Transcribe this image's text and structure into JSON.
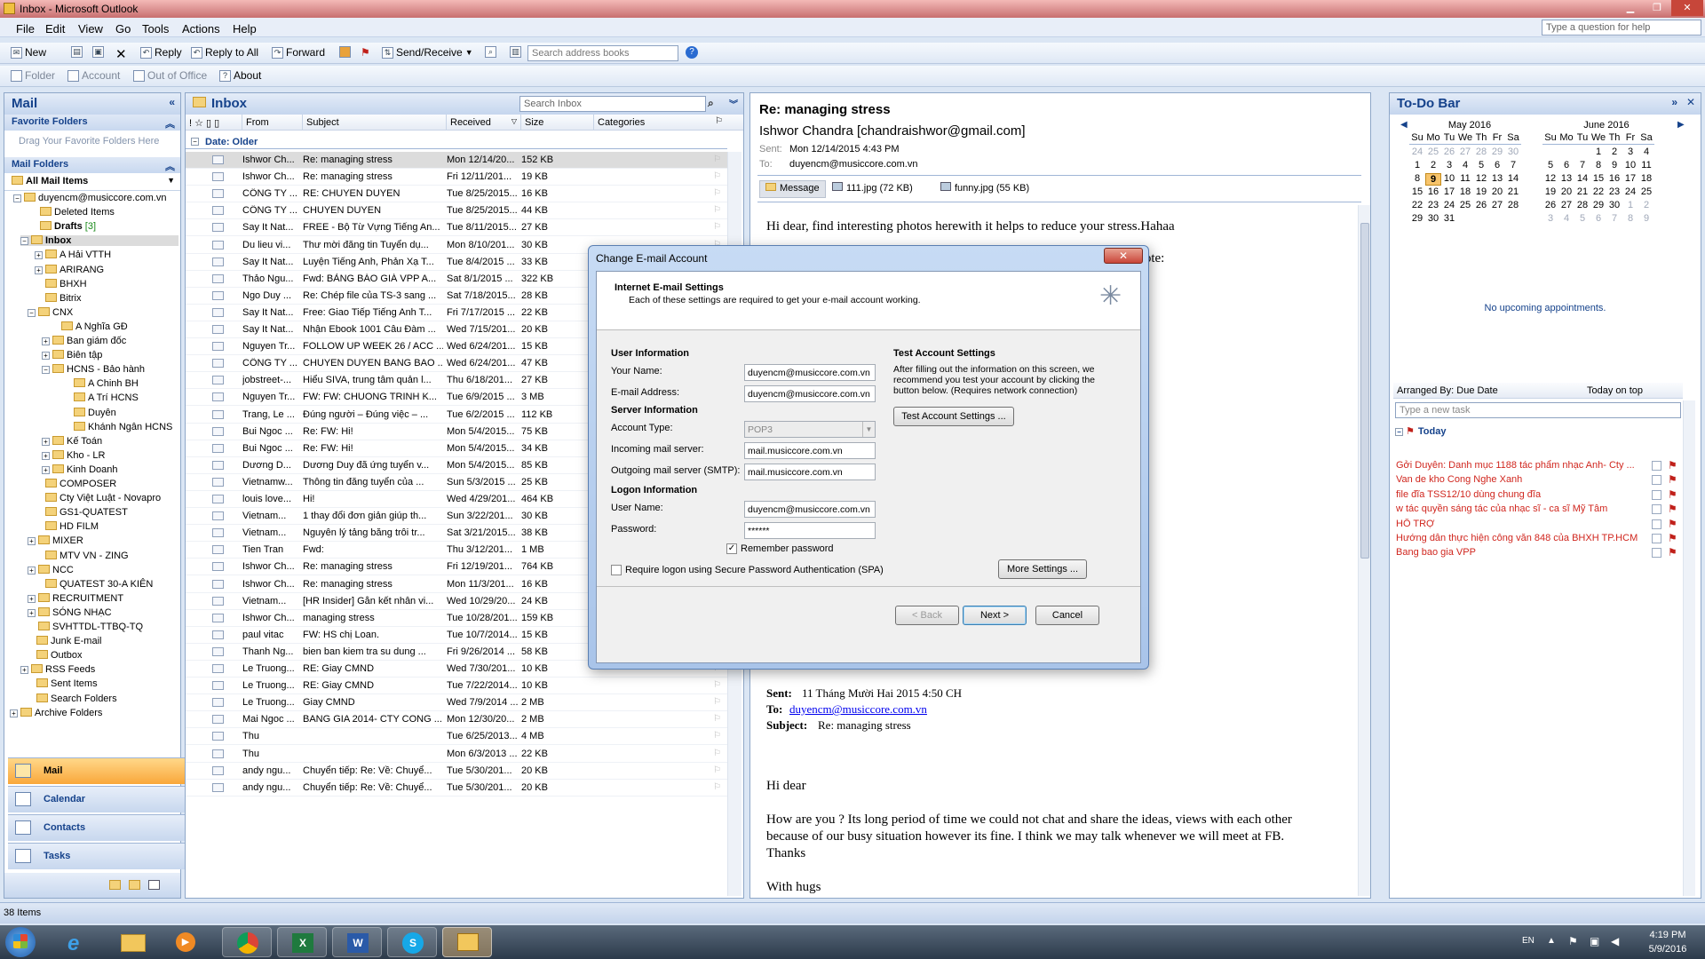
{
  "window": {
    "title": "Inbox - Microsoft Outlook"
  },
  "menu": [
    "File",
    "Edit",
    "View",
    "Go",
    "Tools",
    "Actions",
    "Help"
  ],
  "help_placeholder": "Type a question for help",
  "toolbar1": {
    "new": "New",
    "reply": "Reply",
    "reply_all": "Reply to All",
    "forward": "Forward",
    "send_receive": "Send/Receive",
    "search_placeholder": "Search address books"
  },
  "toolbar2": {
    "folder": "Folder",
    "account": "Account",
    "out_of_office": "Out of Office",
    "about": "About"
  },
  "nav": {
    "title": "Mail",
    "favorite_folders": "Favorite Folders",
    "favorite_hint": "Drag Your Favorite Folders Here",
    "mail_folders": "Mail Folders",
    "all_mail_items": "All Mail Items",
    "tree": [
      "duyencm@musiccore.com.vn",
      "Deleted Items",
      "Drafts",
      "Inbox",
      "A Hải VTTH",
      "ARIRANG",
      "BHXH",
      "Bitrix",
      "CNX",
      "A Nghĩa GĐ",
      "Ban giám đốc",
      "Biên tập",
      "HCNS - Bảo hành",
      "A Chinh BH",
      "A Trí HCNS",
      "Duyên",
      "Khánh Ngân HCNS",
      "Kế Toán",
      "Kho - LR",
      "Kinh Doanh",
      "COMPOSER",
      "Cty Việt Luật - Novapro",
      "GS1-QUATEST",
      "HD FILM",
      "MIXER",
      "MTV VN - ZING",
      "NCC",
      "QUATEST 30-A KIÊN",
      "RECRUITMENT",
      "SÓNG NHẠC",
      "SVHTTDL-TTBQ-TQ",
      "Junk E-mail",
      "Outbox",
      "RSS Feeds",
      "Sent Items",
      "Search Folders",
      "Archive Folders"
    ],
    "drafts_count": "[3]",
    "buttons": [
      "Mail",
      "Calendar",
      "Contacts",
      "Tasks"
    ]
  },
  "inbox": {
    "title": "Inbox",
    "search_placeholder": "Search Inbox",
    "columns": {
      "from": "From",
      "subject": "Subject",
      "received": "Received",
      "size": "Size",
      "categories": "Categories"
    },
    "group": "Date: Older",
    "rows": [
      [
        "Ishwor Ch...",
        "Re: managing stress",
        "Mon 12/14/20...",
        "152 KB"
      ],
      [
        "Ishwor Ch...",
        "Re: managing stress",
        "Fri 12/11/201...",
        "19 KB"
      ],
      [
        "CÔNG TY ...",
        "RE: CHUYEN DUYEN",
        "Tue 8/25/2015...",
        "16 KB"
      ],
      [
        "CÔNG TY ...",
        "CHUYEN DUYEN",
        "Tue 8/25/2015...",
        "44 KB"
      ],
      [
        "Say It Nat...",
        "FREE - Bộ Từ Vựng Tiếng An...",
        "Tue 8/11/2015...",
        "27 KB"
      ],
      [
        "Du lieu vi...",
        "Thư mời đăng tin Tuyển dụ...",
        "Mon 8/10/201...",
        "30 KB"
      ],
      [
        "Say It Nat...",
        "Luyện Tiếng Anh, Phản Xạ T...",
        "Tue 8/4/2015 ...",
        "33 KB"
      ],
      [
        "Thảo Ngu...",
        "Fwd: BẢNG BÁO GIÁ VPP A...",
        "Sat 8/1/2015 ...",
        "322 KB"
      ],
      [
        "Ngo Duy ...",
        "Re: Chép file của TS-3 sang ...",
        "Sat 7/18/2015...",
        "28 KB"
      ],
      [
        "Say It Nat...",
        "Free: Giao Tiếp Tiếng Anh T...",
        "Fri 7/17/2015 ...",
        "22 KB"
      ],
      [
        "Say It Nat...",
        "Nhận Ebook 1001 Câu Đàm ...",
        "Wed 7/15/201...",
        "20 KB"
      ],
      [
        "Nguyen Tr...",
        "FOLLOW UP WEEK 26 / ACC ...",
        "Wed 6/24/201...",
        "15 KB"
      ],
      [
        "CÔNG TY ...",
        "CHUYEN DUYEN BANG BAO ...",
        "Wed 6/24/201...",
        "47 KB"
      ],
      [
        "jobstreet-...",
        "Hiểu SIVA, trung tâm quản l...",
        "Thu 6/18/201...",
        "27 KB"
      ],
      [
        "Nguyen Tr...",
        "FW: FW: CHUONG TRINH K...",
        "Tue 6/9/2015 ...",
        "3 MB"
      ],
      [
        "Trang, Le ...",
        "Đúng người – Đúng việc – ...",
        "Tue 6/2/2015 ...",
        "112 KB"
      ],
      [
        "Bui Ngoc ...",
        "Re: FW: Hi!",
        "Mon 5/4/2015...",
        "75 KB"
      ],
      [
        "Bui Ngoc ...",
        "Re: FW: Hi!",
        "Mon 5/4/2015...",
        "34 KB"
      ],
      [
        "Dương D...",
        "Dương Duy đã ứng tuyển v...",
        "Mon 5/4/2015...",
        "85 KB"
      ],
      [
        "Vietnamw...",
        "Thông tin đăng tuyển của ...",
        "Sun 5/3/2015 ...",
        "25 KB"
      ],
      [
        "louis love...",
        "Hi!",
        "Wed 4/29/201...",
        "464 KB"
      ],
      [
        "Vietnam...",
        "1 thay đổi đơn giản giúp th...",
        "Sun 3/22/201...",
        "30 KB"
      ],
      [
        "Vietnam...",
        "Nguyên lý tảng băng trôi tr...",
        "Sat 3/21/2015...",
        "38 KB"
      ],
      [
        "Tien Tran",
        "Fwd:",
        "Thu 3/12/201...",
        "1 MB"
      ],
      [
        "Ishwor Ch...",
        "Re: managing stress",
        "Fri 12/19/201...",
        "764 KB"
      ],
      [
        "Ishwor Ch...",
        "Re: managing stress",
        "Mon 11/3/201...",
        "16 KB"
      ],
      [
        "Vietnam...",
        "[HR Insider] Gắn kết nhân vi...",
        "Wed 10/29/20...",
        "24 KB"
      ],
      [
        "Ishwor Ch...",
        "managing stress",
        "Tue 10/28/201...",
        "159 KB"
      ],
      [
        "paul vitac",
        "FW: HS chị Loan.",
        "Tue 10/7/2014...",
        "15 KB"
      ],
      [
        "Thanh Ng...",
        "bien ban kiem tra su dung ...",
        "Fri 9/26/2014 ...",
        "58 KB"
      ],
      [
        "Le Truong...",
        "RE: Giay CMND",
        "Wed 7/30/201...",
        "10 KB"
      ],
      [
        "Le Truong...",
        "RE: Giay CMND",
        "Tue 7/22/2014...",
        "10 KB"
      ],
      [
        "Le Truong...",
        "Giay CMND",
        "Wed 7/9/2014 ...",
        "2 MB"
      ],
      [
        "Mai Ngoc ...",
        "BANG GIA 2014- CTY CONG ...",
        "Mon 12/30/20...",
        "2 MB"
      ],
      [
        "Thu",
        "",
        "Tue 6/25/2013...",
        "4 MB"
      ],
      [
        "Thu",
        "",
        "Mon 6/3/2013 ...",
        "22 KB"
      ],
      [
        "andy ngu...",
        "Chuyển tiếp: Re: Về: Chuyể...",
        "Tue 5/30/201...",
        "20 KB"
      ],
      [
        "andy ngu...",
        "Chuyển tiếp: Re: Về: Chuyể...",
        "Tue 5/30/201...",
        "20 KB"
      ]
    ]
  },
  "reading": {
    "subject": "Re: managing stress",
    "sender": "Ishwor Chandra [chandraishwor@gmail.com]",
    "sent_label": "Sent:",
    "sent_value": "Mon 12/14/2015 4:43 PM",
    "to_label": "To:",
    "to_value": "duyencm@musiccore.com.vn",
    "attachments": [
      "Message",
      "111.jpg (72 KB)",
      "funny.jpg (55 KB)"
    ],
    "body1": "Hi dear, find interesting photos herewith it helps to reduce your stress.Hahaa",
    "wrote": "wrote:",
    "q_sent": "Sent:",
    "q_sent_value": "11 Tháng Mười Hai 2015 4:50 CH",
    "q_to": "To:",
    "q_to_value": "duyencm@musiccore.com.vn",
    "q_subject": "Subject:",
    "q_subject_value": "Re: managing stress",
    "q_hi": "Hi dear",
    "q_body1": "How are you ? Its long period of time we could not chat and share the ideas, views with each other",
    "q_body2": "because of our busy situation however its fine. I think we may talk whenever we will meet at FB.",
    "q_thanks": "Thanks",
    "q_hugs": "With hugs"
  },
  "dialog": {
    "title": "Change E-mail Account",
    "header": "Internet E-mail Settings",
    "subheader": "Each of these settings are required to get your e-mail account working.",
    "user_info": "User Information",
    "your_name_label": "Your Name:",
    "your_name": "duyencm@musiccore.com.vn",
    "email_label": "E-mail Address:",
    "email": "duyencm@musiccore.com.vn",
    "server_info": "Server Information",
    "account_type_label": "Account Type:",
    "account_type": "POP3",
    "incoming_label": "Incoming mail server:",
    "incoming": "mail.musiccore.com.vn",
    "outgoing_label": "Outgoing mail server (SMTP):",
    "outgoing": "mail.musiccore.com.vn",
    "logon_info": "Logon Information",
    "username_label": "User Name:",
    "username": "duyencm@musiccore.com.vn",
    "password_label": "Password:",
    "password": "******",
    "remember": "Remember password",
    "spa": "Require logon using Secure Password Authentication (SPA)",
    "test_header": "Test Account Settings",
    "test_text1": "After filling out the information on this screen, we",
    "test_text2": "recommend you test your account by clicking the",
    "test_text3": "button below. (Requires network connection)",
    "test_button": "Test Account Settings ...",
    "more_settings": "More Settings ...",
    "back": "< Back",
    "next": "Next >",
    "cancel": "Cancel"
  },
  "todo": {
    "title": "To-Do Bar",
    "may_title": "May 2016",
    "june_title": "June 2016",
    "weekdays": [
      "Su",
      "Mo",
      "Tu",
      "We",
      "Th",
      "Fr",
      "Sa"
    ],
    "may_days": [
      [
        "24",
        "25",
        "26",
        "27",
        "28",
        "29",
        "30"
      ],
      [
        "1",
        "2",
        "3",
        "4",
        "5",
        "6",
        "7"
      ],
      [
        "8",
        "9",
        "10",
        "11",
        "12",
        "13",
        "14"
      ],
      [
        "15",
        "16",
        "17",
        "18",
        "19",
        "20",
        "21"
      ],
      [
        "22",
        "23",
        "24",
        "25",
        "26",
        "27",
        "28"
      ],
      [
        "29",
        "30",
        "31",
        "",
        "",
        "",
        ""
      ]
    ],
    "june_days": [
      [
        "",
        "",
        "",
        "1",
        "2",
        "3",
        "4"
      ],
      [
        "5",
        "6",
        "7",
        "8",
        "9",
        "10",
        "11"
      ],
      [
        "12",
        "13",
        "14",
        "15",
        "16",
        "17",
        "18"
      ],
      [
        "19",
        "20",
        "21",
        "22",
        "23",
        "24",
        "25"
      ],
      [
        "26",
        "27",
        "28",
        "29",
        "30",
        "1",
        "2"
      ],
      [
        "3",
        "4",
        "5",
        "6",
        "7",
        "8",
        "9"
      ]
    ],
    "no_appointments": "No upcoming appointments.",
    "arranged_by": "Arranged By: Due Date",
    "today_on_top": "Today on top",
    "new_task_placeholder": "Type a new task",
    "today": "Today",
    "tasks": [
      "Gởi Duyên: Danh mục 1188 tác phẩm nhạc Anh- Cty ...",
      "Van de kho Cong Nghe Xanh",
      "file đĩa TSS12/10 dùng chung đĩa",
      "w tác quyền sáng tác của nhạc sĩ - ca sĩ Mỹ Tâm",
      "HỒ TRỢ",
      "Hướng dẫn thực hiện công văn 848 của BHXH TP.HCM",
      "Bang bao gia VPP"
    ]
  },
  "status": {
    "items": "38 Items"
  },
  "taskbar": {
    "lang": "EN",
    "time": "4:19 PM",
    "date": "5/9/2016"
  }
}
